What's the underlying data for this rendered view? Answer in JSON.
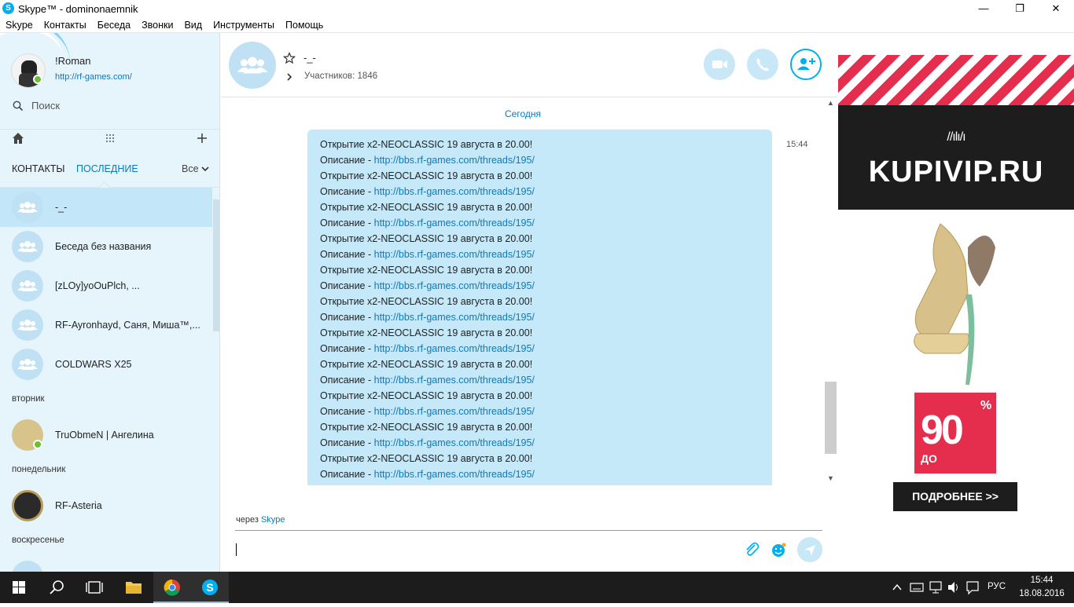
{
  "window": {
    "title": "Skype™ - dominonaemnik",
    "app_icon": "S",
    "controls": {
      "minimize": "—",
      "maximize": "❐",
      "close": "✕"
    }
  },
  "menu": [
    "Skype",
    "Контакты",
    "Беседа",
    "Звонки",
    "Вид",
    "Инструменты",
    "Помощь"
  ],
  "profile": {
    "name": "!Roman",
    "mood_link": "http://rf-games.com/",
    "status": "online"
  },
  "search": {
    "label": "Поиск"
  },
  "sidebar_tabs": {
    "contacts": "КОНТАКТЫ",
    "recent": "ПОСЛЕДНИЕ",
    "filter": "Все"
  },
  "conversations_today": [
    {
      "name": "-_-",
      "selected": true
    },
    {
      "name": "Беседа без названия"
    },
    {
      "name": "[zLOy]yoOuPlch, ..."
    },
    {
      "name": "RF-Ayronhayd, Саня, Миша™,..."
    },
    {
      "name": "COLDWARS X25"
    }
  ],
  "day_groups": [
    {
      "label": "вторник",
      "items": [
        {
          "name": "TruObmeN | Ангелина",
          "online": true
        }
      ]
    },
    {
      "label": "понедельник",
      "items": [
        {
          "name": "RF-Asteria"
        }
      ]
    },
    {
      "label": "воскресенье",
      "items": []
    }
  ],
  "chat": {
    "title": "-_-",
    "participants": "Участников: 1846",
    "day_separator": "Сегодня",
    "message_time": "15:44",
    "message_lines": [
      {
        "text": "Открытие x2-NEOCLASSIC 19 августа в 20.00!"
      },
      {
        "text": "Описание - ",
        "link": "http://bbs.rf-games.com/threads/195/"
      },
      {
        "text": "Открытие x2-NEOCLASSIC 19 августа в 20.00!"
      },
      {
        "text": "Описание - ",
        "link": "http://bbs.rf-games.com/threads/195/"
      },
      {
        "text": "Открытие x2-NEOCLASSIC 19 августа в 20.00!"
      },
      {
        "text": "Описание - ",
        "link": "http://bbs.rf-games.com/threads/195/"
      },
      {
        "text": "Открытие x2-NEOCLASSIC 19 августа в 20.00!"
      },
      {
        "text": "Описание - ",
        "link": "http://bbs.rf-games.com/threads/195/"
      },
      {
        "text": "Открытие x2-NEOCLASSIC 19 августа в 20.00!"
      },
      {
        "text": "Описание - ",
        "link": "http://bbs.rf-games.com/threads/195/"
      },
      {
        "text": "Открытие x2-NEOCLASSIC 19 августа в 20.00!"
      },
      {
        "text": "Описание - ",
        "link": "http://bbs.rf-games.com/threads/195/"
      },
      {
        "text": "Открытие x2-NEOCLASSIC 19 августа в 20.00!"
      },
      {
        "text": "Описание - ",
        "link": "http://bbs.rf-games.com/threads/195/"
      },
      {
        "text": "Открытие x2-NEOCLASSIC 19 августа в 20.00!"
      },
      {
        "text": "Описание - ",
        "link": "http://bbs.rf-games.com/threads/195/"
      },
      {
        "text": "Открытие x2-NEOCLASSIC 19 августа в 20.00!"
      },
      {
        "text": "Описание - ",
        "link": "http://bbs.rf-games.com/threads/195/"
      },
      {
        "text": "Открытие x2-NEOCLASSIC 19 августа в 20.00!"
      },
      {
        "text": "Описание - ",
        "link": "http://bbs.rf-games.com/threads/195/"
      },
      {
        "text": "Открытие x2-NEOCLASSIC 19 августа в 20.00!"
      },
      {
        "text": "Описание - ",
        "link": "http://bbs.rf-games.com/threads/195/"
      }
    ],
    "via_prefix": "через",
    "via_link": "Skype",
    "compose_value": ""
  },
  "ad": {
    "brand": "KUPIVIP.RU",
    "discount_value": "90",
    "discount_percent": "%",
    "discount_prefix": "ДО",
    "button": "ПОДРОБНЕЕ >>"
  },
  "taskbar": {
    "language": "РУС",
    "time": "15:44",
    "date": "18.08.2016"
  },
  "colors": {
    "accent": "#00aff0",
    "link": "#0a7abf",
    "bubble": "#c5e9f9",
    "sidebar_bg": "#e6f4fc",
    "ad_red": "#e52e4d"
  }
}
